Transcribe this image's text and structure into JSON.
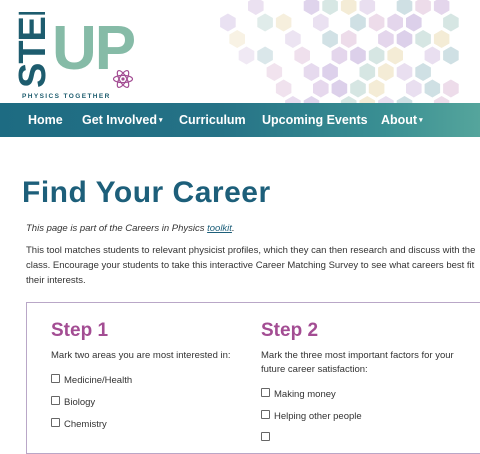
{
  "brand": {
    "logo_step": "STEP",
    "logo_up": "UP",
    "tagline": "PHYSICS TOGETHER",
    "colors": {
      "teal": "#1d6b82",
      "green": "#86bba7",
      "purple": "#a34d93"
    }
  },
  "nav": {
    "items": [
      {
        "label": "Home",
        "dropdown": false
      },
      {
        "label": "Get Involved",
        "dropdown": true
      },
      {
        "label": "Curriculum",
        "dropdown": false
      },
      {
        "label": "Upcoming Events",
        "dropdown": false
      },
      {
        "label": "About",
        "dropdown": true
      }
    ],
    "caret": "▾"
  },
  "page": {
    "title": "Find Your Career",
    "note_prefix": "This page is part of the Careers in Physics ",
    "note_link": "toolkit",
    "note_suffix": ".",
    "description": "This tool matches students to relevant physicist profiles, which they can then research and discuss with the class. Encourage your students to take this interactive Career Matching Survey to see what careers best fit their interests."
  },
  "survey": {
    "step1": {
      "title": "Step 1",
      "instruction": "Mark two areas you are most interested in:",
      "options": [
        "Medicine/Health",
        "Biology",
        "Chemistry"
      ]
    },
    "step2": {
      "title": "Step 2",
      "instruction": "Mark the three most important factors for your future career satisfaction:",
      "options": [
        "Making money",
        "Helping other people"
      ]
    }
  }
}
